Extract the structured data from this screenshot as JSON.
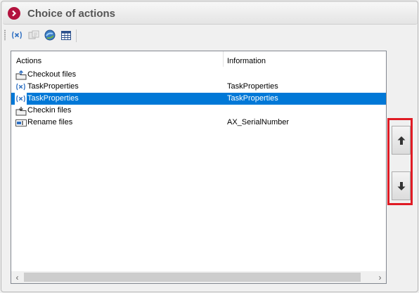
{
  "panel": {
    "title": "Choice of actions"
  },
  "toolbar": {
    "buttons": [
      {
        "icon": "variable-icon",
        "enabled": true
      },
      {
        "icon": "properties-icon",
        "enabled": false
      },
      {
        "icon": "refresh-globe-icon",
        "enabled": true
      },
      {
        "icon": "table-icon",
        "enabled": true
      }
    ]
  },
  "list": {
    "columns": [
      "Actions",
      "Information"
    ],
    "rows": [
      {
        "icon": "checkout-files-icon",
        "action": "Checkout files",
        "info": "",
        "selected": false
      },
      {
        "icon": "variable-icon",
        "action": "TaskProperties",
        "info": "TaskProperties",
        "selected": false
      },
      {
        "icon": "variable-icon",
        "action": "TaskProperties",
        "info": "TaskProperties",
        "selected": true
      },
      {
        "icon": "checkin-files-icon",
        "action": "Checkin files",
        "info": "",
        "selected": false
      },
      {
        "icon": "rename-files-icon",
        "action": "Rename files",
        "info": "AX_SerialNumber",
        "selected": false
      }
    ]
  },
  "move_buttons": {
    "up_icon": "arrow-up-icon",
    "down_icon": "arrow-down-icon"
  },
  "colors": {
    "selection": "#0078d7",
    "highlight_border": "#e01b24",
    "header_icon": "#b3123e"
  }
}
